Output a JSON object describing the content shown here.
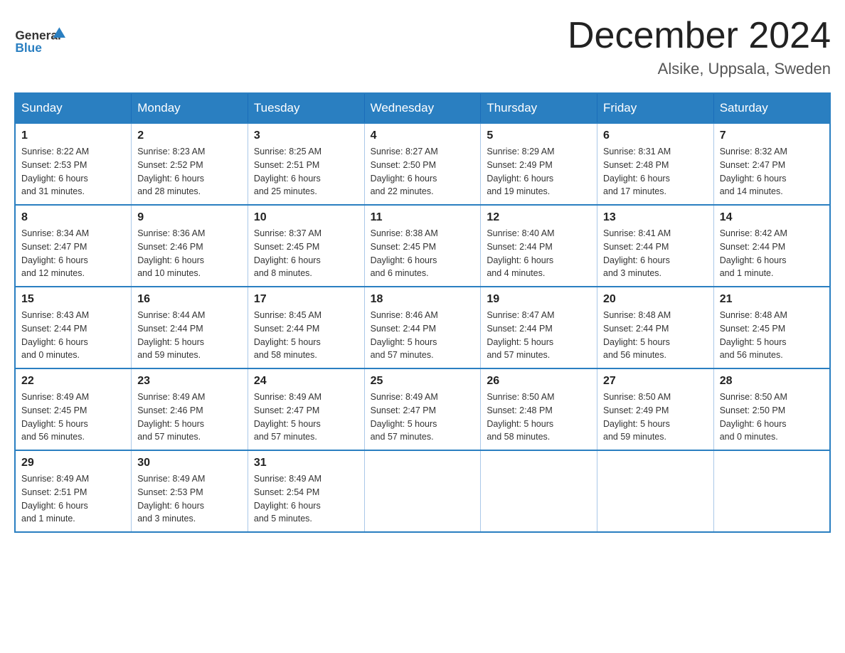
{
  "header": {
    "logo_general": "General",
    "logo_blue": "Blue",
    "month_title": "December 2024",
    "location": "Alsike, Uppsala, Sweden"
  },
  "weekdays": [
    "Sunday",
    "Monday",
    "Tuesday",
    "Wednesday",
    "Thursday",
    "Friday",
    "Saturday"
  ],
  "weeks": [
    [
      {
        "day": "1",
        "sunrise": "8:22 AM",
        "sunset": "2:53 PM",
        "daylight": "6 hours and 31 minutes."
      },
      {
        "day": "2",
        "sunrise": "8:23 AM",
        "sunset": "2:52 PM",
        "daylight": "6 hours and 28 minutes."
      },
      {
        "day": "3",
        "sunrise": "8:25 AM",
        "sunset": "2:51 PM",
        "daylight": "6 hours and 25 minutes."
      },
      {
        "day": "4",
        "sunrise": "8:27 AM",
        "sunset": "2:50 PM",
        "daylight": "6 hours and 22 minutes."
      },
      {
        "day": "5",
        "sunrise": "8:29 AM",
        "sunset": "2:49 PM",
        "daylight": "6 hours and 19 minutes."
      },
      {
        "day": "6",
        "sunrise": "8:31 AM",
        "sunset": "2:48 PM",
        "daylight": "6 hours and 17 minutes."
      },
      {
        "day": "7",
        "sunrise": "8:32 AM",
        "sunset": "2:47 PM",
        "daylight": "6 hours and 14 minutes."
      }
    ],
    [
      {
        "day": "8",
        "sunrise": "8:34 AM",
        "sunset": "2:47 PM",
        "daylight": "6 hours and 12 minutes."
      },
      {
        "day": "9",
        "sunrise": "8:36 AM",
        "sunset": "2:46 PM",
        "daylight": "6 hours and 10 minutes."
      },
      {
        "day": "10",
        "sunrise": "8:37 AM",
        "sunset": "2:45 PM",
        "daylight": "6 hours and 8 minutes."
      },
      {
        "day": "11",
        "sunrise": "8:38 AM",
        "sunset": "2:45 PM",
        "daylight": "6 hours and 6 minutes."
      },
      {
        "day": "12",
        "sunrise": "8:40 AM",
        "sunset": "2:44 PM",
        "daylight": "6 hours and 4 minutes."
      },
      {
        "day": "13",
        "sunrise": "8:41 AM",
        "sunset": "2:44 PM",
        "daylight": "6 hours and 3 minutes."
      },
      {
        "day": "14",
        "sunrise": "8:42 AM",
        "sunset": "2:44 PM",
        "daylight": "6 hours and 1 minute."
      }
    ],
    [
      {
        "day": "15",
        "sunrise": "8:43 AM",
        "sunset": "2:44 PM",
        "daylight": "6 hours and 0 minutes."
      },
      {
        "day": "16",
        "sunrise": "8:44 AM",
        "sunset": "2:44 PM",
        "daylight": "5 hours and 59 minutes."
      },
      {
        "day": "17",
        "sunrise": "8:45 AM",
        "sunset": "2:44 PM",
        "daylight": "5 hours and 58 minutes."
      },
      {
        "day": "18",
        "sunrise": "8:46 AM",
        "sunset": "2:44 PM",
        "daylight": "5 hours and 57 minutes."
      },
      {
        "day": "19",
        "sunrise": "8:47 AM",
        "sunset": "2:44 PM",
        "daylight": "5 hours and 57 minutes."
      },
      {
        "day": "20",
        "sunrise": "8:48 AM",
        "sunset": "2:44 PM",
        "daylight": "5 hours and 56 minutes."
      },
      {
        "day": "21",
        "sunrise": "8:48 AM",
        "sunset": "2:45 PM",
        "daylight": "5 hours and 56 minutes."
      }
    ],
    [
      {
        "day": "22",
        "sunrise": "8:49 AM",
        "sunset": "2:45 PM",
        "daylight": "5 hours and 56 minutes."
      },
      {
        "day": "23",
        "sunrise": "8:49 AM",
        "sunset": "2:46 PM",
        "daylight": "5 hours and 57 minutes."
      },
      {
        "day": "24",
        "sunrise": "8:49 AM",
        "sunset": "2:47 PM",
        "daylight": "5 hours and 57 minutes."
      },
      {
        "day": "25",
        "sunrise": "8:49 AM",
        "sunset": "2:47 PM",
        "daylight": "5 hours and 57 minutes."
      },
      {
        "day": "26",
        "sunrise": "8:50 AM",
        "sunset": "2:48 PM",
        "daylight": "5 hours and 58 minutes."
      },
      {
        "day": "27",
        "sunrise": "8:50 AM",
        "sunset": "2:49 PM",
        "daylight": "5 hours and 59 minutes."
      },
      {
        "day": "28",
        "sunrise": "8:50 AM",
        "sunset": "2:50 PM",
        "daylight": "6 hours and 0 minutes."
      }
    ],
    [
      {
        "day": "29",
        "sunrise": "8:49 AM",
        "sunset": "2:51 PM",
        "daylight": "6 hours and 1 minute."
      },
      {
        "day": "30",
        "sunrise": "8:49 AM",
        "sunset": "2:53 PM",
        "daylight": "6 hours and 3 minutes."
      },
      {
        "day": "31",
        "sunrise": "8:49 AM",
        "sunset": "2:54 PM",
        "daylight": "6 hours and 5 minutes."
      },
      null,
      null,
      null,
      null
    ]
  ],
  "labels": {
    "sunrise": "Sunrise:",
    "sunset": "Sunset:",
    "daylight": "Daylight:"
  }
}
